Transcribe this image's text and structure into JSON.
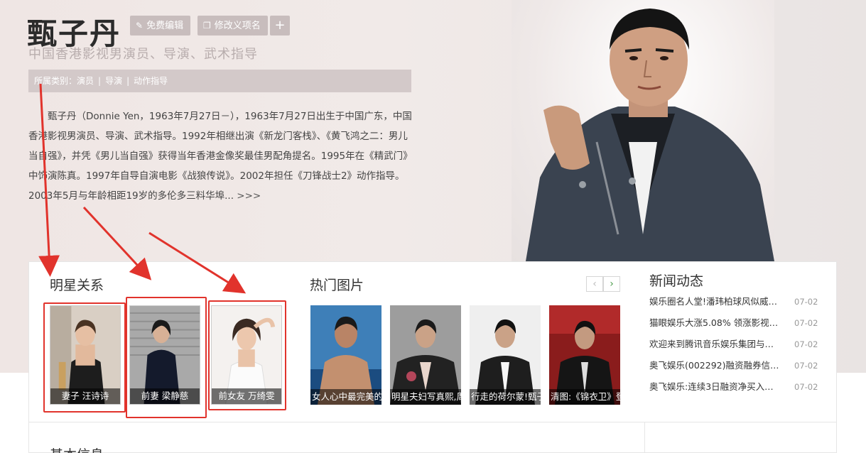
{
  "header": {
    "name": "甄子丹",
    "edit_button": "免费编辑",
    "rename_button": "修改义项名",
    "add_button": "+",
    "subtitle": "中国香港影视男演员、导演、武术指导",
    "category_label": "所属类别：",
    "categories": [
      "演员",
      "导演",
      "动作指导"
    ],
    "category_sep": "|"
  },
  "summary": {
    "text": "甄子丹（Donnie Yen，1963年7月27日－），1963年7月27日出生于中国广东，中国香港影视男演员、导演、武术指导。1992年相继出演《新龙门客栈》、《黄飞鸿之二：男儿当自强》，并凭《男儿当自强》获得当年香港金像奖最佳男配角提名。1995年在《精武门》中饰演陈真。1997年自导自演电影《战狼传说》。2002年担任《刀锋战士2》动作指导。2003年5月与年龄相距19岁的多伦多三料华埠...",
    "more": ">>>"
  },
  "relations": {
    "title": "明星关系",
    "items": [
      {
        "label": "妻子 汪诗诗"
      },
      {
        "label": "前妻 梁静慈"
      },
      {
        "label": "前女友 万绮雯"
      }
    ]
  },
  "hot_pics": {
    "title": "热门图片",
    "prev": "‹",
    "next": "›",
    "items": [
      {
        "caption": "女人心中最完美的"
      },
      {
        "caption": "明星夫妇写真熙,周"
      },
      {
        "caption": "行走的荷尔蒙!甄子"
      },
      {
        "caption": "清图:《锦衣卫》登"
      }
    ]
  },
  "news": {
    "title": "新闻动态",
    "items": [
      {
        "title": "娱乐圈名人堂!潘玮柏球风似威…",
        "date": "07-02"
      },
      {
        "title": "猫眼娱乐大涨5.08% 领涨影视…",
        "date": "07-02"
      },
      {
        "title": "欢迎来到腾讯音乐娱乐集团与…",
        "date": "07-02"
      },
      {
        "title": "奥飞娱乐(002292)融资融券信…",
        "date": "07-02"
      },
      {
        "title": "奥飞娱乐:连续3日融资净买入…",
        "date": "07-02"
      }
    ]
  },
  "basic_info": {
    "title": "基本信息"
  },
  "colors": {
    "highlight": "#e1332c",
    "hero_bg": "#efe6e4",
    "category_bar": "#d3c9c9",
    "button_bg": "#c8bdbd",
    "next_arrow": "#4a9a4a"
  },
  "icons": {
    "edit": "pencil-icon",
    "rename": "tag-icon",
    "add": "plus-icon"
  }
}
